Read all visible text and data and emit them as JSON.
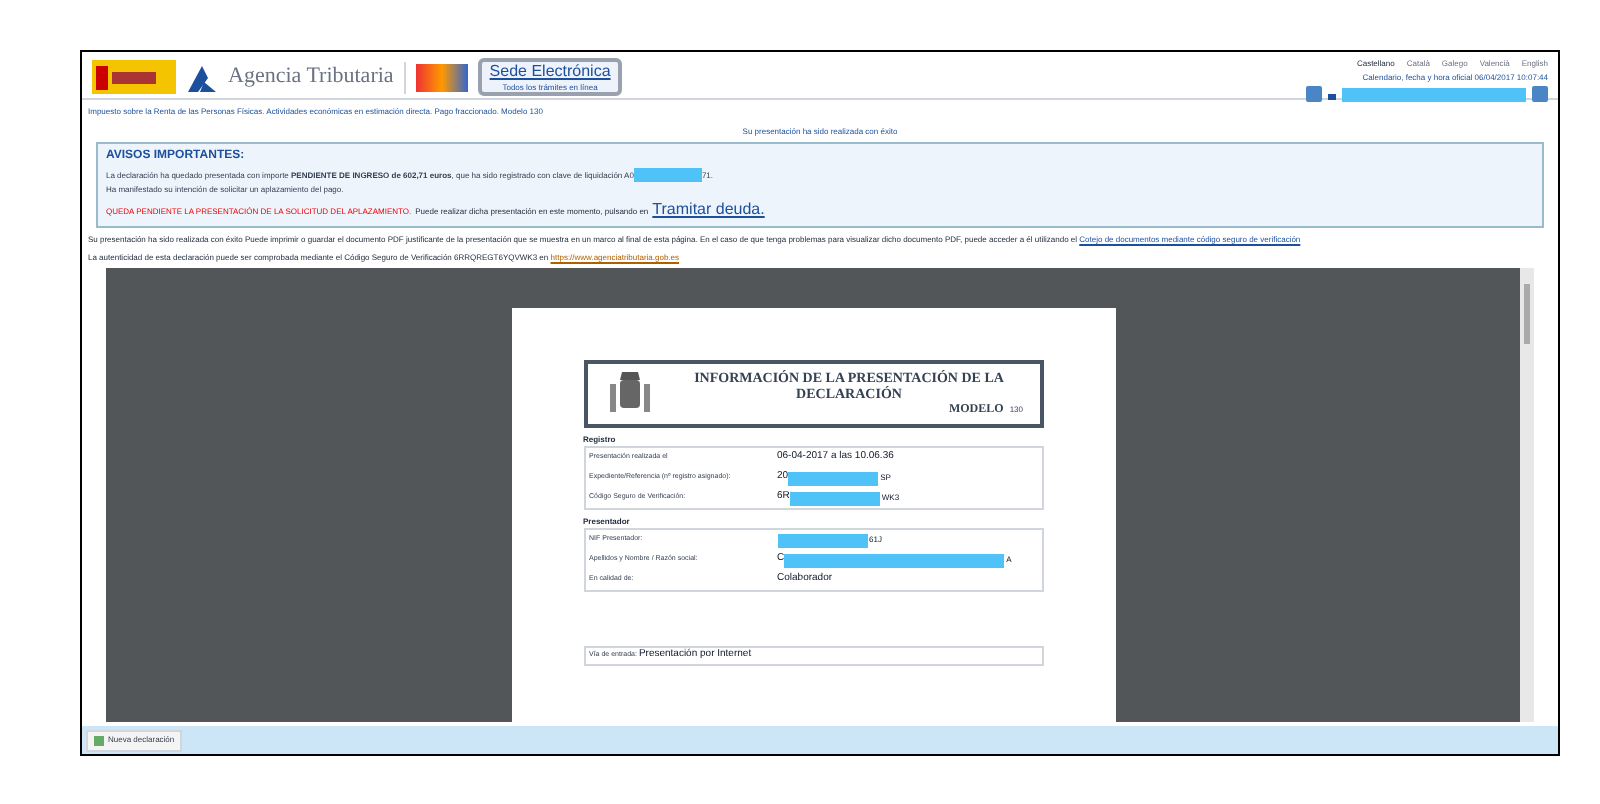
{
  "header": {
    "agency": "Agencia Tributaria",
    "sede": "Sede Electrónica",
    "sede_tagline": "Todos los trámites en línea",
    "languages": [
      {
        "label": "Castellano",
        "selected": true
      },
      {
        "label": "Català",
        "selected": false
      },
      {
        "label": "Galego",
        "selected": false
      },
      {
        "label": "Valencià",
        "selected": false
      },
      {
        "label": "English",
        "selected": false
      }
    ],
    "clock": "Calendario, fecha y hora oficial 06/04/2017 10:07:44"
  },
  "breadcrumb": "Impuesto sobre la Renta de las Personas Físicas. Actividades económicas en estimación directa. Pago fraccionado. Modelo 130",
  "success": "Su presentación ha sido realizada con éxito",
  "notice": {
    "title": "AVISOS IMPORTANTES:",
    "line1_before": "La declaración ha quedado presentada con importe ",
    "line1_bold": "PENDIENTE DE INGRESO de 602,71 euros",
    "line1_mid": ", que ha sido registrado con clave de liquidación A0",
    "line1_after": "71.",
    "line2": "Ha manifestado su intención de solicitar un aplazamiento del pago.",
    "warning": "QUEDA PENDIENTE LA PRESENTACIÓN DE LA SOLICITUD DEL APLAZAMIENTO.",
    "warning_rest": "Puede realizar dicha presentación en este momento, pulsando en",
    "link": "Tramitar deuda."
  },
  "info_text": "Su presentación ha sido realizada con éxito Puede imprimir o guardar el documento PDF justificante de la presentación que se muestra en un marco al final de esta página. En el caso de que tenga problemas para visualizar dicho documento PDF, puede acceder a él utilizando el",
  "info_link": "Cotejo de documentos mediante código seguro de verificación",
  "csv_text": "La autenticidad de esta declaración puede ser comprobada mediante el Código Seguro de Verificación 6RRQREGT6YQVWK3 en",
  "csv_link": "https://www.agenciatributaria.gob.es",
  "pdf": {
    "title": "INFORMACIÓN DE LA PRESENTACIÓN DE LA DECLARACIÓN",
    "modelo_label": "MODELO",
    "modelo": "130",
    "sections": [
      {
        "title": "Registro",
        "rows": [
          {
            "label": "Presentación realizada el",
            "value": "06-04-2017 a las 10.06.36",
            "redacted": false,
            "suffix": ""
          },
          {
            "label": "Expediente/Referencia (nº registro asignado):",
            "value": "20",
            "redacted": true,
            "suffix": "SP"
          },
          {
            "label": "Código Seguro de Verificación:",
            "value": "6R",
            "redacted": true,
            "suffix": "WK3"
          }
        ]
      },
      {
        "title": "Presentador",
        "rows": [
          {
            "label": "NIF Presentador:",
            "value": "",
            "redacted": true,
            "suffix": "61J"
          },
          {
            "label": "Apellidos y Nombre / Razón social:",
            "value": "C",
            "redacted": true,
            "suffix": "A"
          },
          {
            "label": "En calidad de:",
            "value": "Colaborador",
            "redacted": false,
            "suffix": ""
          }
        ]
      }
    ],
    "footer_label": "Vía de entrada:",
    "footer_value": "Presentación por Internet"
  },
  "bottom_button": "Nueva declaración"
}
